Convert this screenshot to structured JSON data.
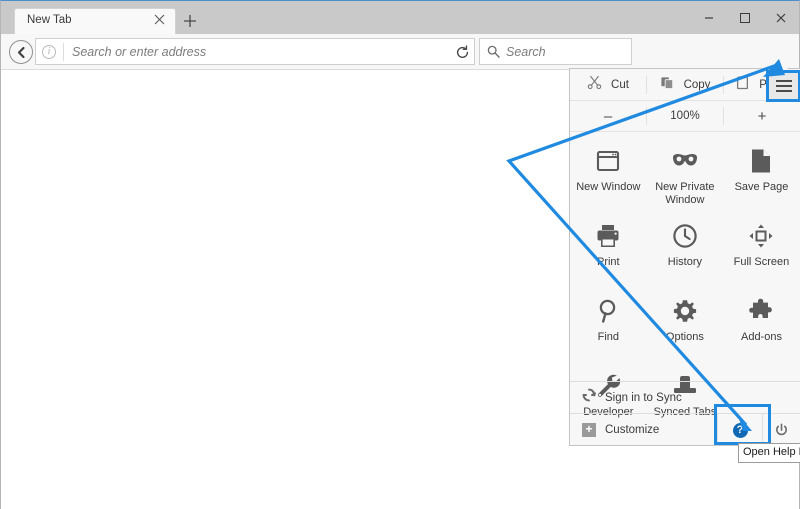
{
  "window": {
    "titlebar": {
      "tab_label": "New Tab",
      "close_icon": "close-icon",
      "newtab_icon": "plus-icon",
      "minimize_label": "–",
      "maximize_label": "",
      "close_label": "✕"
    },
    "navbar": {
      "back_icon": "back-arrow-icon",
      "identity_icon": "info-icon",
      "identity_glyph": "i",
      "address_placeholder": "Search or enter address",
      "address_value": "",
      "reload_icon": "reload-icon",
      "search_icon": "search-icon",
      "search_placeholder": "Search",
      "search_value": "",
      "icons": [
        {
          "name": "bookmark-star-icon",
          "glyph": "☆"
        },
        {
          "name": "library-icon",
          "glyph": ""
        },
        {
          "name": "downloads-icon",
          "glyph": ""
        },
        {
          "name": "home-icon",
          "glyph": ""
        },
        {
          "name": "pocket-icon",
          "glyph": ""
        }
      ],
      "hamburger_icon": "hamburger-menu-icon"
    }
  },
  "menu": {
    "edit_row": [
      {
        "label": "Cut",
        "icon": "scissors-icon"
      },
      {
        "label": "Copy",
        "icon": "copy-icon"
      },
      {
        "label": "Paste",
        "icon": "paste-icon"
      }
    ],
    "zoom": {
      "minus_label": "–",
      "level": "100%",
      "plus_label": "+"
    },
    "grid": [
      {
        "label": "New Window",
        "icon": "new-window-icon"
      },
      {
        "label": "New Private Window",
        "icon": "private-browsing-mask-icon"
      },
      {
        "label": "Save Page",
        "icon": "save-page-icon"
      },
      {
        "label": "Print",
        "icon": "printer-icon"
      },
      {
        "label": "History",
        "icon": "clock-history-icon"
      },
      {
        "label": "Full Screen",
        "icon": "full-screen-icon"
      },
      {
        "label": "Find",
        "icon": "magnifier-find-icon"
      },
      {
        "label": "Options",
        "icon": "gear-options-icon"
      },
      {
        "label": "Add-ons",
        "icon": "puzzle-addons-icon"
      },
      {
        "label": "Developer",
        "icon": "wrench-developer-icon"
      },
      {
        "label": "Synced Tabs",
        "icon": "synced-tabs-icon"
      }
    ],
    "footer": {
      "sync_label": "Sign in to Sync",
      "sync_icon": "sync-icon",
      "customize_label": "Customize",
      "customize_icon": "plus-square-icon",
      "help_icon": "help-question-icon",
      "help_glyph": "?",
      "quit_icon": "power-quit-icon"
    }
  },
  "tooltip": {
    "text": "Open Help Me"
  },
  "annotation": {
    "accent_color": "#1f8ae0",
    "highlight_targets": [
      "hamburger-menu-icon",
      "help-question-icon"
    ]
  }
}
